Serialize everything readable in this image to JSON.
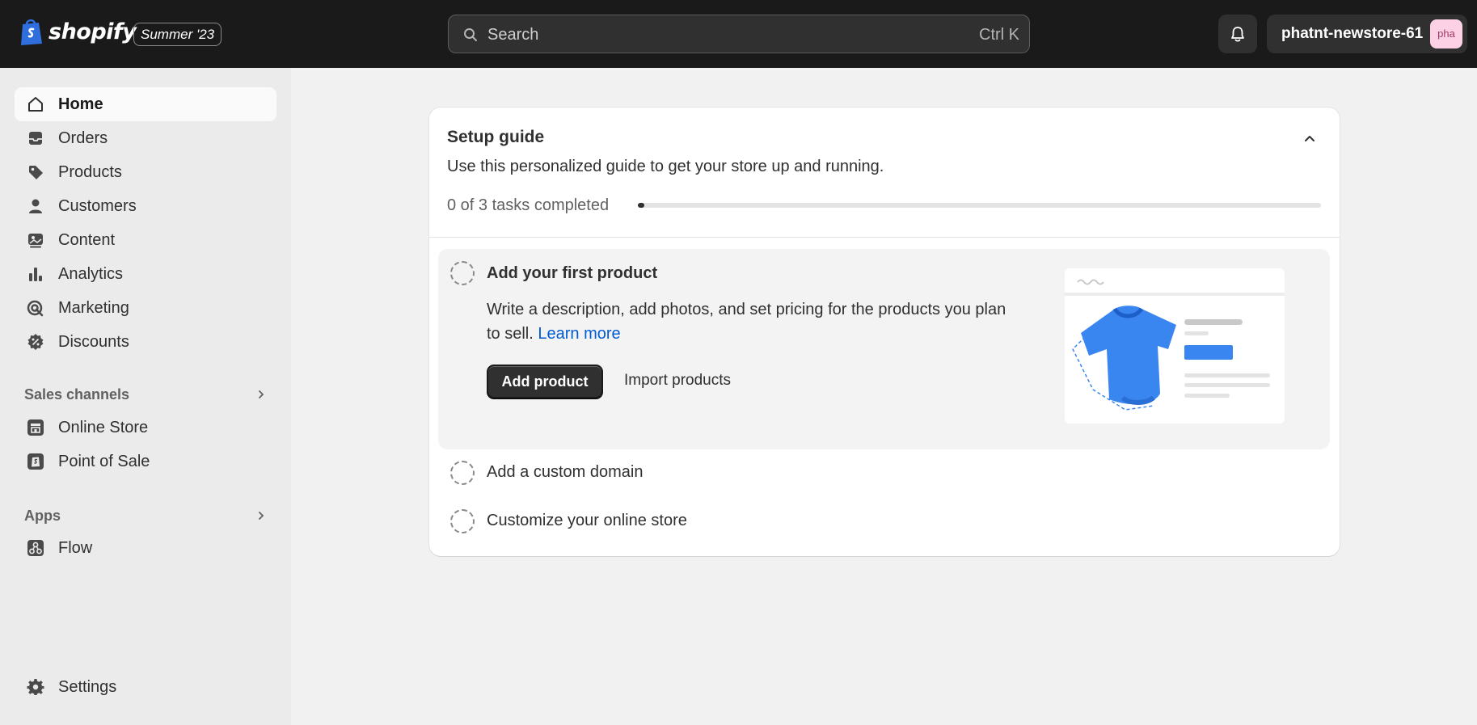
{
  "topbar": {
    "brand": "shopify",
    "edition": "Summer '23",
    "search_placeholder": "Search",
    "search_shortcut": "Ctrl K",
    "store_name": "phatnt-newstore-61",
    "avatar_initials": "pha"
  },
  "sidebar": {
    "items": [
      {
        "label": "Home",
        "icon": "home-icon",
        "active": true
      },
      {
        "label": "Orders",
        "icon": "inbox-icon"
      },
      {
        "label": "Products",
        "icon": "tag-icon"
      },
      {
        "label": "Customers",
        "icon": "person-icon"
      },
      {
        "label": "Content",
        "icon": "image-icon"
      },
      {
        "label": "Analytics",
        "icon": "bar-chart-icon"
      },
      {
        "label": "Marketing",
        "icon": "target-icon"
      },
      {
        "label": "Discounts",
        "icon": "discount-icon"
      }
    ],
    "sales_channels": {
      "label": "Sales channels",
      "items": [
        {
          "label": "Online Store",
          "icon": "store-icon"
        },
        {
          "label": "Point of Sale",
          "icon": "pos-icon"
        }
      ]
    },
    "apps": {
      "label": "Apps",
      "items": [
        {
          "label": "Flow",
          "icon": "flow-icon"
        }
      ]
    },
    "settings": {
      "label": "Settings",
      "icon": "gear-icon"
    }
  },
  "setup_guide": {
    "title": "Setup guide",
    "subtitle": "Use this personalized guide to get your store up and running.",
    "progress_text": "0 of 3 tasks completed",
    "progress_fraction": 0.01,
    "tasks": [
      {
        "title": "Add your first product",
        "description": "Write a description, add photos, and set pricing for the products you plan to sell.",
        "link": "Learn more",
        "primary_action": "Add product",
        "secondary_action": "Import products",
        "illustration": "t-shirt-product-illustration"
      },
      {
        "title": "Add a custom domain"
      },
      {
        "title": "Customize your online store"
      }
    ]
  },
  "colors": {
    "topbar_bg": "#1a1a1a",
    "page_bg": "#f1f1f1",
    "link": "#005bd3",
    "brand_green": "#95bf47",
    "tshirt_blue": "#3a86f0"
  }
}
